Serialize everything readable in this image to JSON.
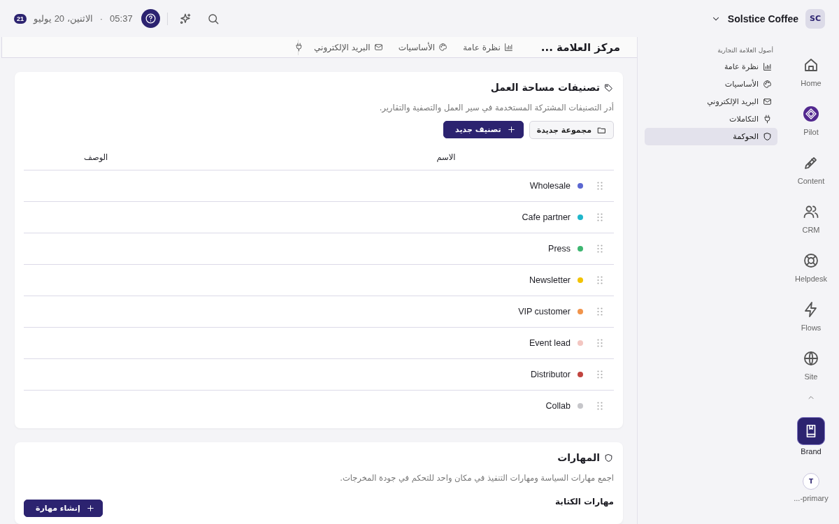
{
  "workspace": {
    "initials": "SC",
    "name": "Solstice Coffee"
  },
  "topbar": {
    "time": "05:37",
    "separator": "·",
    "date": "الاثنين، 20 يوليو",
    "badge": "21"
  },
  "rail": [
    {
      "kind": "home",
      "label": "Home",
      "selected": false
    },
    {
      "kind": "pilot",
      "label": "Pilot",
      "selected": false
    },
    {
      "kind": "content",
      "label": "Content",
      "selected": false
    },
    {
      "kind": "crm",
      "label": "CRM",
      "selected": false
    },
    {
      "kind": "helpdesk",
      "label": "Helpdesk",
      "selected": false
    },
    {
      "kind": "flows",
      "label": "Flows",
      "selected": false
    },
    {
      "kind": "site",
      "label": "Site",
      "selected": false
    },
    {
      "kind": "collapse",
      "selected": false
    },
    {
      "kind": "brand",
      "label": "Brand",
      "selected": true
    },
    {
      "kind": "avatar",
      "initial": "T",
      "label": "...-primary",
      "selected": false
    }
  ],
  "sidebar": {
    "heading": "أصول العلامة التجارية",
    "items": [
      {
        "label": "نظرة عامة",
        "selected": false
      },
      {
        "label": "الأساسيات",
        "selected": false
      },
      {
        "label": "البريد الإلكتروني",
        "selected": false
      },
      {
        "label": "التكاملات",
        "selected": false
      },
      {
        "label": "الحوكمة",
        "selected": true
      }
    ]
  },
  "header": {
    "title": "مركز العلامة ...",
    "tabs": [
      {
        "label": "نظرة عامة",
        "selected": false
      },
      {
        "label": "الأساسيات",
        "selected": false
      },
      {
        "label": "البريد الإلكتروني",
        "selected": false
      }
    ]
  },
  "tags_card": {
    "title": "تصنيفات مساحة العمل",
    "description": "أدر التصنيفات المشتركة المستخدمة في سير العمل والتصفية والتقارير.",
    "new_group": "مجموعة جديدة",
    "new_tag": "تصنيف جديد",
    "columns": [
      "الاسم",
      "الوصف"
    ],
    "rows": [
      {
        "name": "Wholesale",
        "color": "#5b67d1"
      },
      {
        "name": "Cafe partner",
        "color": "#1fb6cb"
      },
      {
        "name": "Press",
        "color": "#3db671"
      },
      {
        "name": "Newsletter",
        "color": "#f2c300"
      },
      {
        "name": "VIP customer",
        "color": "#f1944b"
      },
      {
        "name": "Event lead",
        "color": "#f3c6c1"
      },
      {
        "name": "Distributor",
        "color": "#c1443f"
      },
      {
        "name": "Collab",
        "color": "#c6c6ca"
      }
    ]
  },
  "skills_card": {
    "title": "المهارات",
    "description": "اجمع مهارات السياسة ومهارات التنفيذ في مكان واحد للتحكم في جودة المخرجات.",
    "section": "مهارات الكتابة",
    "create": "إنشاء مهارة"
  }
}
